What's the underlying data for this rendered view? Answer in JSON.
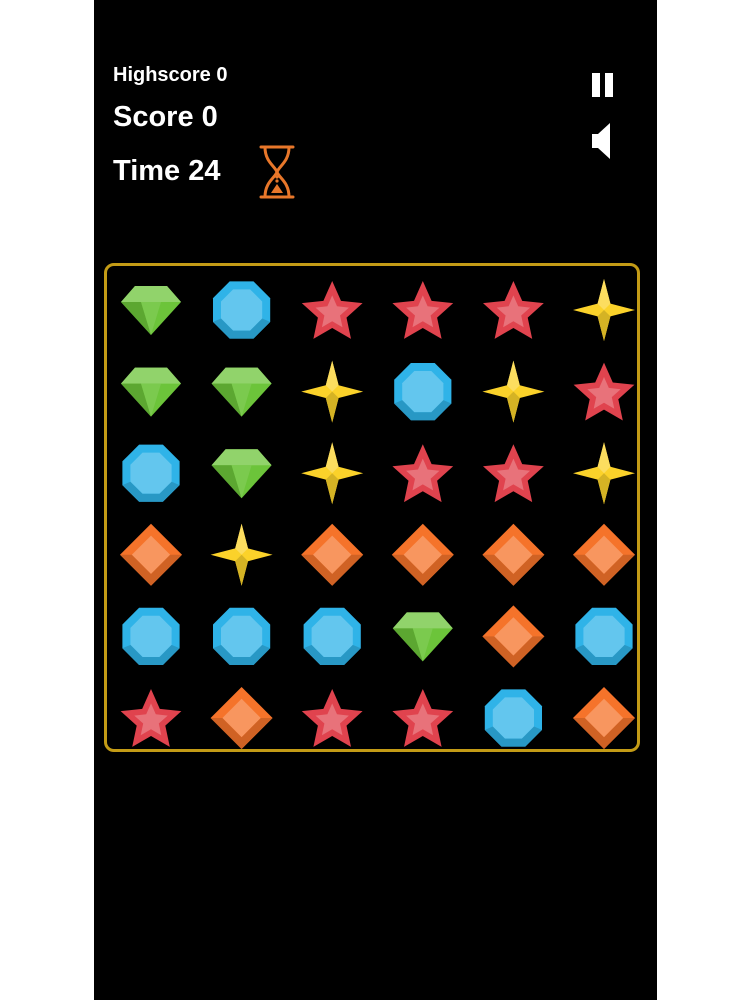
{
  "hud": {
    "highscore_label": "Highscore 0",
    "score_label": "Score 0",
    "time_label": "Time 24"
  },
  "icons": {
    "hourglass": "hourglass-icon",
    "pause": "pause-icon",
    "sound": "speaker-icon"
  },
  "colors": {
    "background": "#000000",
    "board_border": "#c39b16",
    "hourglass": "#e8772a",
    "green": "#6cc43a",
    "blue": "#2fb3e8",
    "red": "#e0434e",
    "yellow": "#fbd22a",
    "orange": "#f5732a"
  },
  "board": {
    "rows": 6,
    "cols": 6,
    "grid": [
      [
        "green",
        "blue",
        "red",
        "red",
        "red",
        "yellow"
      ],
      [
        "green",
        "green",
        "yellow",
        "blue",
        "yellow",
        "red"
      ],
      [
        "blue",
        "green",
        "yellow",
        "red",
        "red",
        "yellow"
      ],
      [
        "orange",
        "yellow",
        "orange",
        "orange",
        "orange",
        "orange"
      ],
      [
        "blue",
        "blue",
        "blue",
        "green",
        "orange",
        "blue"
      ],
      [
        "red",
        "orange",
        "red",
        "red",
        "blue",
        "orange"
      ]
    ]
  }
}
